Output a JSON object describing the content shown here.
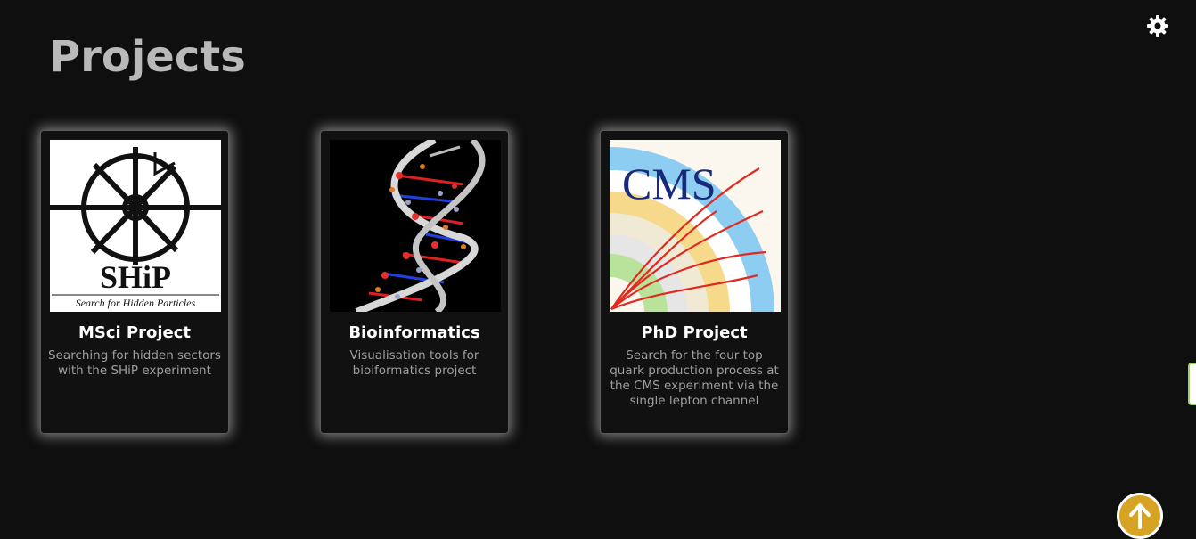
{
  "page": {
    "title": "Projects"
  },
  "header": {
    "settings_icon": "gear-icon"
  },
  "cards": [
    {
      "title": "MSci Project",
      "description": "Searching for hidden sectors with the SHiP experiment",
      "image": {
        "logo_text": "SHiP",
        "tagline": "Search for Hidden Particles"
      }
    },
    {
      "title": "Bioinformatics",
      "description": "Visualisation tools for bioiformatics project",
      "image": {
        "subject": "dna-double-helix"
      }
    },
    {
      "title": "PhD Project",
      "description": "Search for the four top quark production process at the CMS experiment via the single lepton channel",
      "image": {
        "logo_text": "CMS"
      }
    }
  ],
  "footer": {
    "scroll_top_icon": "arrow-up-icon"
  },
  "colors": {
    "background": "#0f0f0f",
    "title": "#b9b9b9",
    "card_description": "#9e9e9e",
    "scroll_button": "#d6a324"
  }
}
